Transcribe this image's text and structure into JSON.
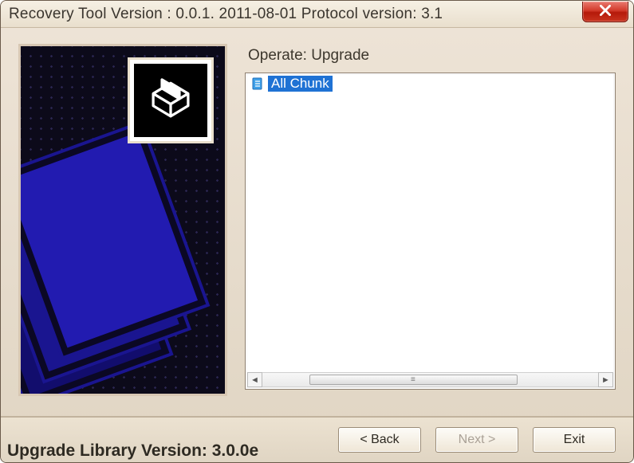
{
  "title": "Recovery Tool Version : 0.0.1. 2011-08-01 Protocol version: 3.1",
  "operate_label": "Operate: Upgrade",
  "tree": {
    "items": [
      {
        "label": "All Chunk",
        "selected": true
      }
    ]
  },
  "buttons": {
    "back": "< Back",
    "next": "Next >",
    "exit": "Exit"
  },
  "footer": {
    "lib_version": "Upgrade Library Version: 3.0.0e"
  }
}
